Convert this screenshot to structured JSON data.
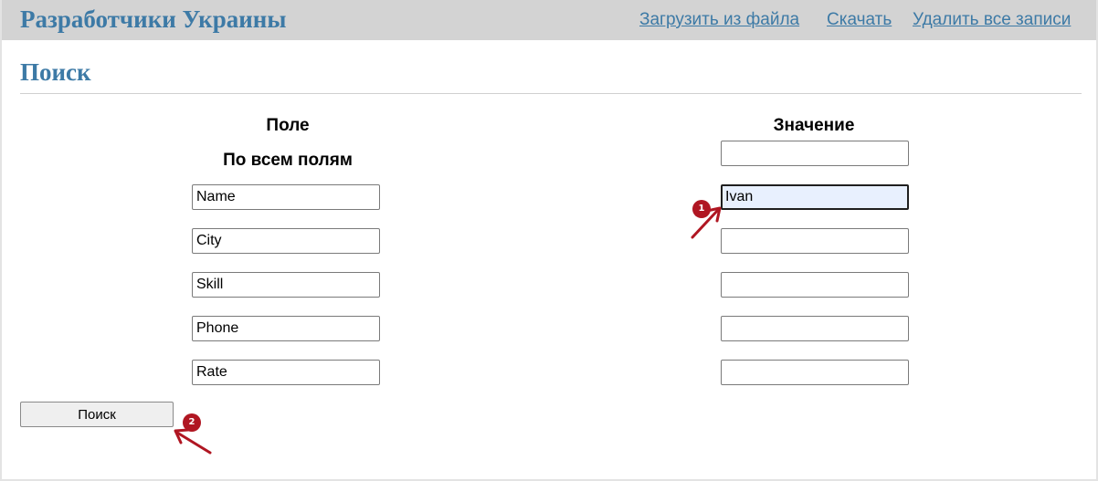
{
  "header": {
    "title": "Разработчики Украины",
    "links": {
      "upload": "Загрузить из файла",
      "download": "Скачать",
      "delete_all": "Удалить все записи"
    }
  },
  "search": {
    "title": "Поиск",
    "column_field": "Поле",
    "column_value": "Значение",
    "all_fields_label": "По всем полям",
    "rows": [
      {
        "field": "Name",
        "value": "Ivan"
      },
      {
        "field": "City",
        "value": ""
      },
      {
        "field": "Skill",
        "value": ""
      },
      {
        "field": "Phone",
        "value": ""
      },
      {
        "field": "Rate",
        "value": ""
      }
    ],
    "all_fields_value": "",
    "button_label": "Поиск"
  },
  "annotations": {
    "marker_1": "1",
    "marker_2": "2",
    "color": "#b01622"
  }
}
